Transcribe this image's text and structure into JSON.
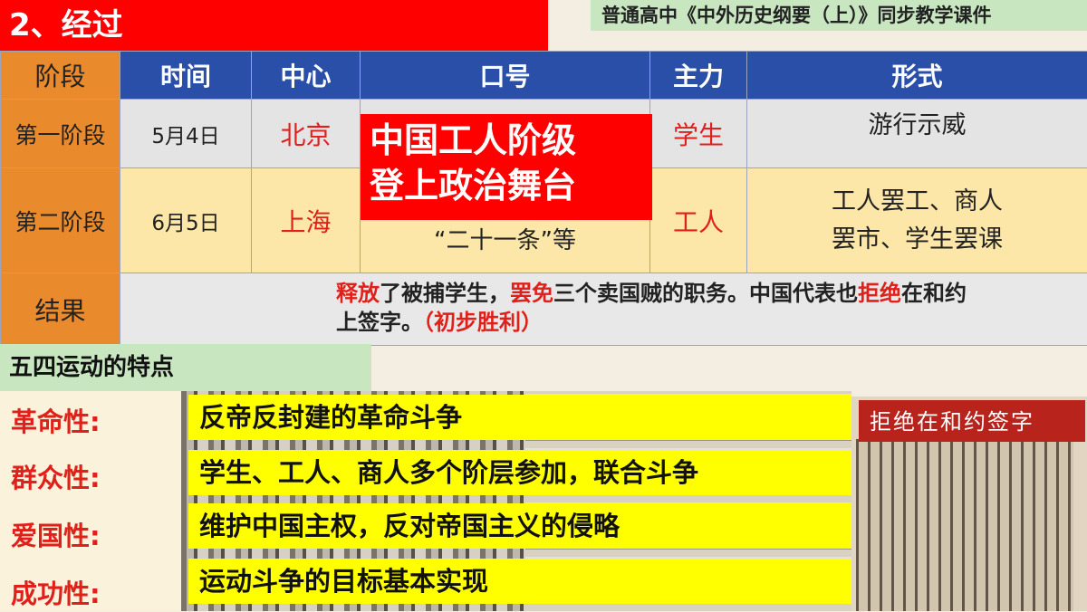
{
  "title": "2、经过",
  "course": "普通高中《中外历史纲要（上）》同步教学课件",
  "table": {
    "headers": [
      "阶段",
      "时间",
      "中心",
      "口号",
      "主力",
      "形式"
    ],
    "rows": [
      {
        "stage": "第一阶段",
        "date": "5月4日",
        "center": "北京",
        "slogan": "",
        "force": "学生",
        "form": "游行示威"
      },
      {
        "stage": "第二阶段",
        "date": "6月5日",
        "center": "上海",
        "slogan": "“二十一条”等",
        "force": "工人",
        "form_line1": "工人罢工、商人",
        "form_line2": "罢市、学生罢课"
      }
    ],
    "result": {
      "label": "结果",
      "p1": "释放",
      "p2": "了被捕学生，",
      "p3": "罢免",
      "p4": "三个卖国贼的职务。中国代表也",
      "p5": "拒绝",
      "p6": "在和约",
      "p7": "上签字。",
      "p8": "（初步胜利）"
    }
  },
  "overlay": {
    "line1": "中国工人阶级",
    "line2": "登上政治舞台"
  },
  "features": {
    "heading": "五四运动的特点",
    "items": [
      {
        "label": "革命性:",
        "text": "反帝反封建的革命斗争"
      },
      {
        "label": "群众性:",
        "text": "学生、工人、商人多个阶层参加，联合斗争"
      },
      {
        "label": "爱国性:",
        "text": "维护中国主权，反对帝国主义的侵略"
      },
      {
        "label": "成功性:",
        "text": "运动斗争的目标基本实现"
      }
    ]
  },
  "photo_caption": "拒绝在和约签字",
  "colors": {
    "title_red": "#ff0000",
    "header_blue": "#2a4fa8",
    "stage_orange": "#e98a2c",
    "highlight_yellow": "#ffff00",
    "label_green": "#c8e6c0"
  }
}
